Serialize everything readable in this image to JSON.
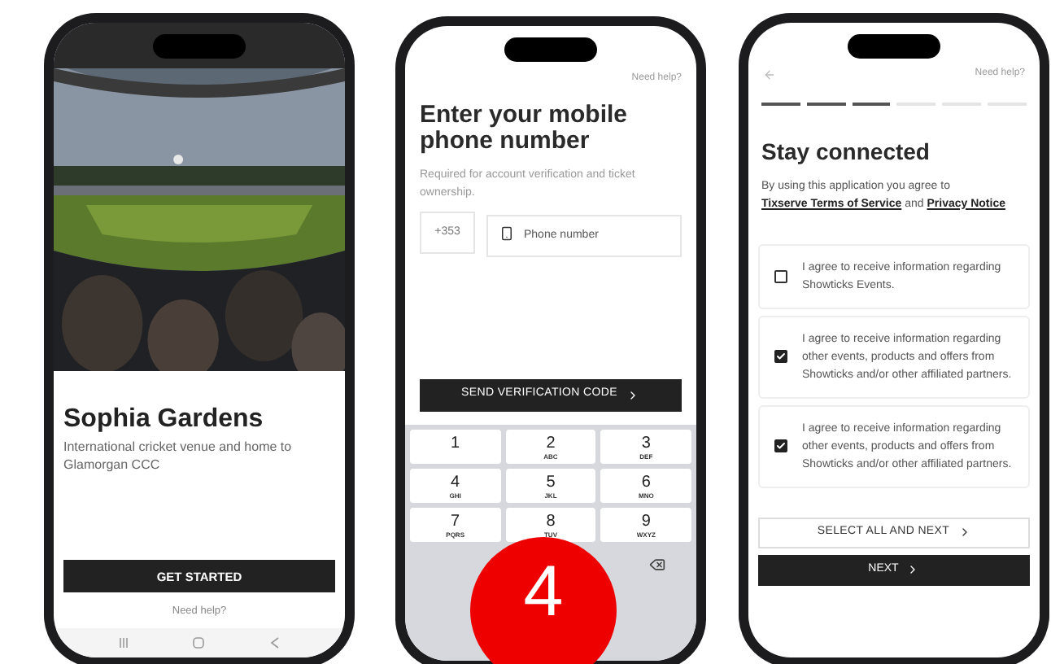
{
  "venue_screen": {
    "title": "Sophia Gardens",
    "subtitle": "International cricket venue and home to Glamorgan CCC",
    "button": "GET STARTED",
    "help_link": "Need help?"
  },
  "phone_screen": {
    "help_link": "Need help?",
    "title": "Enter your mobile phone number",
    "subtitle": "Required for account verification and ticket ownership.",
    "country_code": "+353",
    "phone_placeholder": "Phone number",
    "button": "SEND VERIFICATION CODE",
    "keypad": [
      {
        "digit": "1"
      },
      {
        "digit": "2",
        "letters": "ABC"
      },
      {
        "digit": "3",
        "letters": "DEF"
      },
      {
        "digit": "4",
        "letters": "GHI"
      },
      {
        "digit": "5",
        "letters": "JKL"
      },
      {
        "digit": "6",
        "letters": "MNO"
      },
      {
        "digit": "7",
        "letters": "PQRS"
      },
      {
        "digit": "8",
        "letters": "TUV"
      },
      {
        "digit": "9",
        "letters": "WXYZ"
      }
    ]
  },
  "consent_screen": {
    "help_link": "Need help?",
    "progress": [
      {
        "done": true
      },
      {
        "done": true
      },
      {
        "done": true
      },
      {
        "done": false
      },
      {
        "done": false
      },
      {
        "done": false
      }
    ],
    "title": "Stay connected",
    "intro": "By using this application you agree to",
    "terms_link": "Tixserve Terms of Service",
    "joiner": "and",
    "privacy_link": "Privacy Notice",
    "options": [
      {
        "label": "I agree to receive information regarding Showticks Events.",
        "checked": false
      },
      {
        "label": "I agree to receive information regarding other events, products and offers from Showticks and/or other affiliated partners.",
        "checked": true
      },
      {
        "label": "I agree to receive information regarding other events, products and offers from Showticks and/or other affiliated partners.",
        "checked": true
      }
    ],
    "secondary_button": "SELECT ALL AND NEXT",
    "primary_button": "NEXT"
  },
  "step_badge": "4"
}
